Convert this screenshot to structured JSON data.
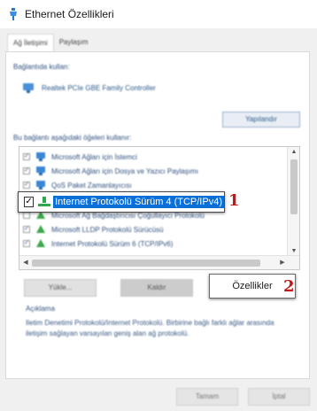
{
  "window": {
    "title": "Ethernet Özellikleri"
  },
  "tabs": [
    {
      "label": "Ağ İletişimi"
    },
    {
      "label": "Paylaşım"
    }
  ],
  "connection": {
    "label": "Bağlantıda kullan:",
    "adapter_name": "Realtek PCIe GBE Family Controller",
    "configure_label": "Yapılandır"
  },
  "items_label": "Bu bağlantı aşağıdaki öğeleri kullanır:",
  "items": [
    {
      "label": "Microsoft Ağları için İstemci",
      "checked": true
    },
    {
      "label": "Microsoft Ağları için Dosya ve Yazıcı Paylaşımı",
      "checked": true
    },
    {
      "label": "QoS Paket Zamanlayıcısı",
      "checked": true
    },
    {
      "label": "Internet Protokolü Sürüm 4 (TCP/IPv4)",
      "checked": true
    },
    {
      "label": "Microsoft Ağ Bağdaştırıcısı Çoğullayıcı Protokolü",
      "checked": false
    },
    {
      "label": "Microsoft LLDP Protokolü Sürücüsü",
      "checked": true
    },
    {
      "label": "Internet Protokolü Sürüm 6 (TCP/IPv6)",
      "checked": true
    }
  ],
  "highlight": {
    "label": "Internet Protokolü Sürüm 4 (TCP/IPv4)",
    "marker": "1"
  },
  "buttons": {
    "install": "Yükle...",
    "uninstall": "Kaldır",
    "properties": "Özellikler",
    "properties_marker": "2"
  },
  "description": {
    "title": "Açıklama",
    "text": "Iletim Denetimi Protokolü/Internet Protokolü. Birbirine bağlı farklı ağlar arasında iletişim sağlayan varsayılan geniş alan ağ protokolü."
  },
  "dialog": {
    "ok": "Tamam",
    "cancel": "İptal"
  },
  "colors": {
    "accent": "#0a6fd8",
    "marker": "#c01818"
  }
}
